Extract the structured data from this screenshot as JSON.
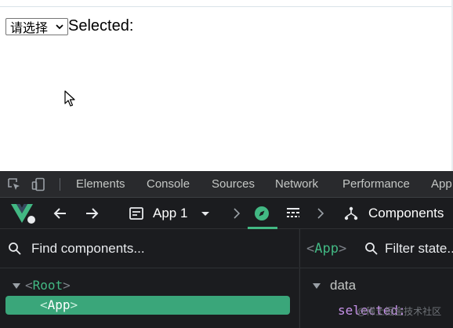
{
  "page": {
    "select_value": "请选择",
    "selected_label": "Selected:"
  },
  "devtools": {
    "tabs": [
      "Elements",
      "Console",
      "Sources",
      "Network",
      "Performance",
      "App"
    ],
    "vue": {
      "app_selector": "App 1",
      "components_label": "Components",
      "find_placeholder": "Find components...",
      "tree": {
        "root": "Root",
        "child": "App"
      },
      "inspector": {
        "component": "App",
        "filter_placeholder": "Filter state...",
        "section": "data",
        "prop_key": "selected:"
      }
    },
    "watermark": "@稀土掘金技术社区"
  },
  "colors": {
    "accent": "#42b883",
    "devtools_bg": "#1b1c1f"
  }
}
